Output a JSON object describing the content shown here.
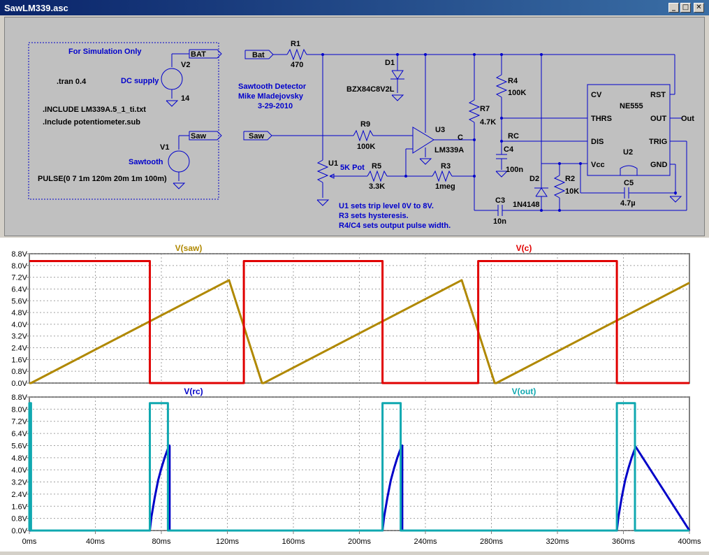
{
  "window": {
    "title": "SawLM339.asc"
  },
  "schematic": {
    "sim_box_title": "For Simulation Only",
    "directives": [
      ".tran 0.4",
      ".INCLUDE LM339A.5_1_ti.txt",
      ".Include potentiometer.sub"
    ],
    "dc_label": "DC supply",
    "saw_label": "Sawtooth",
    "pulse": "PULSE(0 7 1m 120m 20m 1m 100m)",
    "title_lines": [
      "Sawtooth Detector",
      "Mike Mladejovsky",
      "3-29-2010"
    ],
    "notes": [
      "U1 sets trip level 0V to 8V.",
      "R3 sets hysteresis.",
      "R4/C4 sets output pulse width."
    ],
    "labels": {
      "bat": "BAT",
      "bat2": "Bat",
      "saw": "Saw",
      "saw2": "Saw",
      "out": "Out",
      "v2": "V2",
      "v2val": "14",
      "v1": "V1",
      "r1": "R1",
      "r1v": "470",
      "d1": "D1",
      "d1v": "BZX84C8V2L",
      "r9": "R9",
      "r9v": "100K",
      "u3": "U3",
      "u3v": "LM339A",
      "c": "C",
      "u1": "U1",
      "u1v": "5K Pot",
      "r5": "R5",
      "r5v": "3.3K",
      "r3": "R3",
      "r3v": "1meg",
      "r7": "R7",
      "r7v": "4.7K",
      "r4": "R4",
      "r4v": "100K",
      "rc": "RC",
      "c4": "C4",
      "c4v": "100n",
      "d2": "D2",
      "d2v": "1N4148",
      "r2": "R2",
      "r2v": "10K",
      "c3": "C3",
      "c3v": "10n",
      "c5": "C5",
      "c5v": "4.7µ",
      "u2": "U2",
      "u2v": "NE555",
      "cv": "CV",
      "rst": "RST",
      "thrs": "THRS",
      "out_pin": "OUT",
      "dis": "DIS",
      "trig": "TRIG",
      "vcc": "Vcc",
      "gnd": "GND"
    }
  },
  "chart_data": [
    {
      "type": "line",
      "xlabel": "",
      "ylabel": "",
      "xlim": [
        0,
        400
      ],
      "ylim": [
        0,
        8.8
      ],
      "grid": true,
      "series": [
        {
          "name": "V(saw)",
          "color": "#b08800",
          "x": [
            0,
            1,
            121,
            141,
            142,
            262,
            282,
            283,
            400
          ],
          "y": [
            0,
            0,
            7,
            0,
            0,
            7,
            0,
            0,
            6.82
          ]
        },
        {
          "name": "V(c)",
          "color": "#e00000",
          "x": [
            0,
            73,
            73,
            130,
            130,
            214,
            214,
            272,
            272,
            356,
            356,
            400
          ],
          "y": [
            8.3,
            8.3,
            0,
            0,
            8.3,
            8.3,
            0,
            0,
            8.3,
            8.3,
            0,
            0
          ]
        }
      ]
    },
    {
      "type": "line",
      "xlabel": "",
      "ylabel": "",
      "xlim": [
        0,
        400
      ],
      "ylim": [
        0,
        8.8
      ],
      "grid": true,
      "series": [
        {
          "name": "V(rc)",
          "color": "#0000c8",
          "x": [
            0,
            73,
            74,
            76,
            78,
            80,
            82,
            84,
            85,
            85,
            214,
            215,
            217,
            219,
            221,
            223,
            225,
            226,
            226,
            356,
            357,
            359,
            361,
            363,
            365,
            367,
            367,
            400
          ],
          "y": [
            0,
            0,
            0.9,
            2.2,
            3.3,
            4.1,
            4.8,
            5.4,
            5.6,
            0,
            0,
            0.9,
            2.2,
            3.3,
            4.1,
            4.8,
            5.4,
            5.6,
            0,
            0,
            0.9,
            2.2,
            3.3,
            4.1,
            4.8,
            5.4,
            5.6,
            0
          ]
        },
        {
          "name": "V(out)",
          "color": "#10a8b0",
          "x": [
            0,
            0,
            1,
            1,
            73,
            73,
            84,
            84,
            214,
            214,
            225,
            225,
            356,
            356,
            367,
            367,
            400
          ],
          "y": [
            0,
            8.4,
            8.4,
            0,
            0,
            8.4,
            8.4,
            0,
            0,
            8.4,
            8.4,
            0,
            0,
            8.4,
            8.4,
            0,
            0
          ]
        }
      ]
    }
  ],
  "axes": {
    "y_ticks": [
      "0.0V",
      "0.8V",
      "1.6V",
      "2.4V",
      "3.2V",
      "4.0V",
      "4.8V",
      "5.6V",
      "6.4V",
      "7.2V",
      "8.0V",
      "8.8V"
    ],
    "x_ticks": [
      "0ms",
      "40ms",
      "80ms",
      "120ms",
      "160ms",
      "200ms",
      "240ms",
      "280ms",
      "320ms",
      "360ms",
      "400ms"
    ]
  }
}
